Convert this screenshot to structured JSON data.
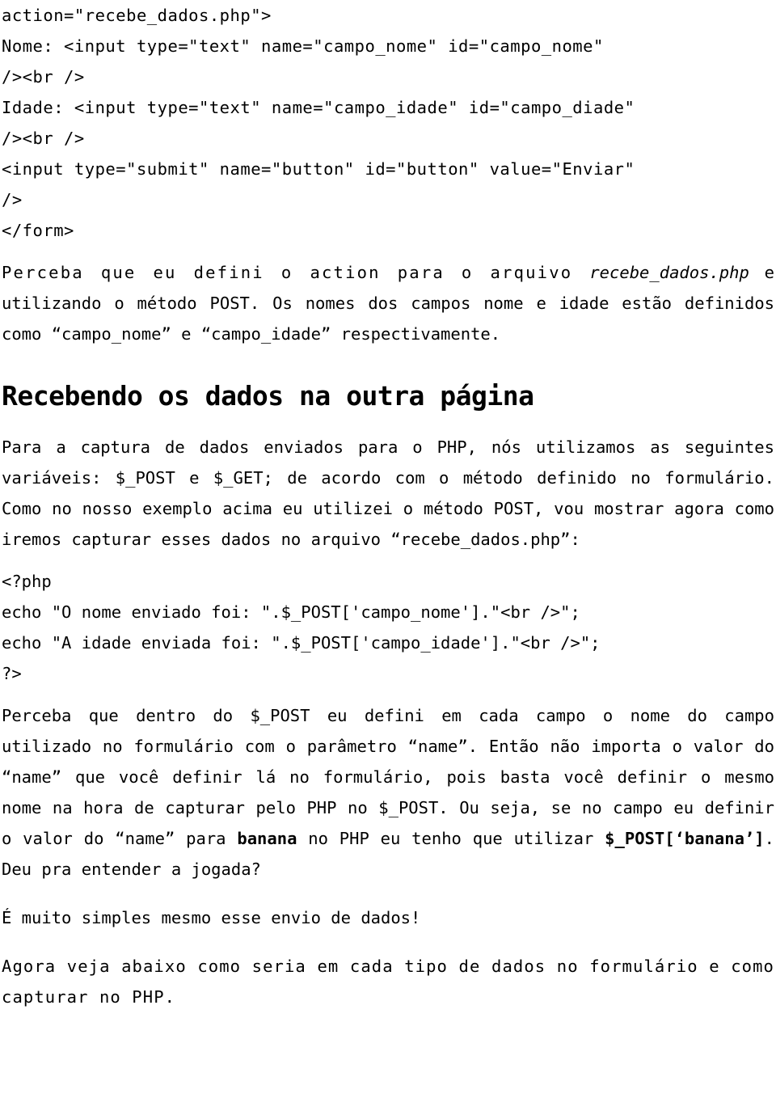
{
  "document": {
    "code_block_1": [
      "action=\"recebe_dados.php\">",
      "Nome: <input type=\"text\" name=\"campo_nome\" id=\"campo_nome\"",
      "/><br />",
      "Idade: <input type=\"text\" name=\"campo_idade\" id=\"campo_diade\"",
      "/><br />",
      "<input type=\"submit\" name=\"button\" id=\"button\" value=\"Enviar\"",
      "/>",
      "</form>"
    ],
    "paragraph_1_part_1": "Perceba que eu defini o action para o arquivo ",
    "paragraph_1_italic": "recebe_dados.php",
    "paragraph_1_part_2": " e utilizando o método POST. Os nomes dos campos nome e idade estão definidos como “campo_nome” e “campo_idade” respectivamente.",
    "heading_1": "Recebendo os dados na outra página",
    "paragraph_2": "Para a captura de dados enviados para o PHP, nós utilizamos as seguintes variáveis: $_POST e $_GET; de acordo com o método definido no formulário. Como no nosso exemplo acima eu utilizei o método POST, vou mostrar agora como iremos capturar esses dados no arquivo “recebe_dados.php”:",
    "code_block_2": [
      "<?php",
      "echo \"O nome enviado foi: \".$_POST['campo_nome'].\"<br />\";",
      "echo \"A idade enviada foi: \".$_POST['campo_idade'].\"<br />\";",
      "?>"
    ],
    "paragraph_3_part_1": "Perceba que dentro do $_POST eu defini em cada campo o nome do campo utilizado no formulário com o parâmetro “name”. Então não importa o valor do “name” que você definir lá no formulário, pois basta você definir o mesmo nome na hora de capturar pelo PHP no $_POST. Ou seja, se no campo eu definir o valor do “name” para ",
    "paragraph_3_bold_1": "banana",
    "paragraph_3_part_2": " no PHP eu tenho que utilizar ",
    "paragraph_3_bold_2": "$_POST[‘banana’]",
    "paragraph_3_part_3": ". Deu pra entender a jogada?",
    "paragraph_4": "É muito simples mesmo esse envio de dados!",
    "paragraph_5": "Agora veja abaixo como seria em cada tipo de dados no formulário e como capturar no PHP."
  }
}
